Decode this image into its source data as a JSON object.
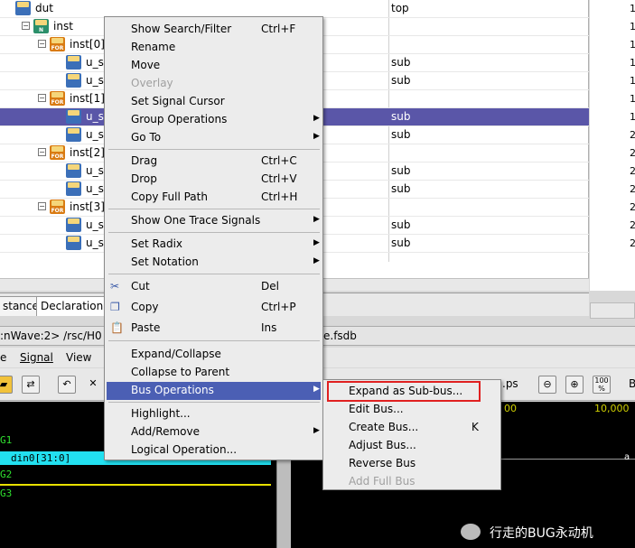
{
  "tree": {
    "rows": [
      {
        "name": "dut",
        "value": "top",
        "icon": "module-icon"
      },
      {
        "name": "inst",
        "value": "",
        "icon": "net-icon"
      },
      {
        "name": "inst[0]",
        "value": "",
        "icon": "for-icon"
      },
      {
        "name": "u_s",
        "value": "sub",
        "icon": "module-icon"
      },
      {
        "name": "u_s",
        "value": "sub",
        "icon": "module-icon"
      },
      {
        "name": "inst[1]",
        "value": "",
        "icon": "for-icon"
      },
      {
        "name": "u_s",
        "value": "sub",
        "icon": "module-icon"
      },
      {
        "name": "u_s",
        "value": "sub",
        "icon": "module-icon"
      },
      {
        "name": "inst[2]",
        "value": "",
        "icon": "for-icon"
      },
      {
        "name": "u_s",
        "value": "sub",
        "icon": "module-icon"
      },
      {
        "name": "u_s",
        "value": "sub",
        "icon": "module-icon"
      },
      {
        "name": "inst[3]",
        "value": "",
        "icon": "for-icon"
      },
      {
        "name": "u_s",
        "value": "sub",
        "icon": "module-icon"
      },
      {
        "name": "u_s",
        "value": "sub",
        "icon": "module-icon"
      }
    ],
    "icon_labels": {
      "net": "N",
      "for": "FOR",
      "module": ""
    },
    "right_column_numbers": [
      "1",
      "1",
      "1",
      "1",
      "1",
      "1",
      "1",
      "2",
      "2",
      "2",
      "2",
      "2",
      "2",
      "2"
    ]
  },
  "tabs": [
    "stance",
    "Declaration"
  ],
  "window_title": ":nWave:2> /rsc/H0",
  "window_title_tail": "e.fsdb",
  "menubar": [
    "e",
    "Signal",
    "View"
  ],
  "toolbar": {
    "time_unit": ".ps",
    "zoom_pct": "100 %",
    "ruler_label": "00",
    "ruler_label_2": "10,000"
  },
  "signals": [
    {
      "name": "G1",
      "color": "#2fe02f"
    },
    {
      "name": "din0[31:0]",
      "color": "#000000"
    },
    {
      "name": "G2",
      "color": "#2fe02f"
    },
    {
      "name": "G3",
      "color": "#2fe02f"
    }
  ],
  "wave_marker": "a",
  "context_menu": {
    "items": [
      {
        "label": "Show Search/Filter",
        "shortcut": "Ctrl+F"
      },
      {
        "label": "Rename"
      },
      {
        "label": "Move"
      },
      {
        "label": "Overlay",
        "disabled": true
      },
      {
        "label": "Set Signal Cursor"
      },
      {
        "label": "Group Operations",
        "submenu": true
      },
      {
        "label": "Go To",
        "submenu": true
      },
      {
        "label": "Drag",
        "shortcut": "Ctrl+C"
      },
      {
        "label": "Drop",
        "shortcut": "Ctrl+V"
      },
      {
        "label": "Copy Full Path",
        "shortcut": "Ctrl+H"
      },
      {
        "label": "Show One Trace Signals",
        "submenu": true
      },
      {
        "label": "Set Radix",
        "submenu": true
      },
      {
        "label": "Set Notation",
        "submenu": true
      },
      {
        "label": "Cut",
        "shortcut": "Del",
        "icon": "scissors-icon"
      },
      {
        "label": "Copy",
        "shortcut": "Ctrl+P",
        "icon": "copy-icon"
      },
      {
        "label": "Paste",
        "shortcut": "Ins",
        "icon": "paste-icon"
      },
      {
        "label": "Expand/Collapse"
      },
      {
        "label": "Collapse to Parent"
      },
      {
        "label": "Bus Operations",
        "submenu": true,
        "highlighted": true
      },
      {
        "label": "Highlight..."
      },
      {
        "label": "Add/Remove",
        "submenu": true
      },
      {
        "label": "Logical Operation..."
      }
    ]
  },
  "bus_submenu": {
    "items": [
      {
        "label": "Expand as Sub-bus..."
      },
      {
        "label": "Edit Bus..."
      },
      {
        "label": "Create Bus...",
        "shortcut": "K"
      },
      {
        "label": "Adjust Bus..."
      },
      {
        "label": "Reverse Bus"
      },
      {
        "label": "Add Full Bus",
        "disabled": true
      }
    ]
  },
  "watermark": "行走的BUG永动机",
  "colors": {
    "selection": "#5a56a8",
    "menu_highlight": "#4b5fb4",
    "callout": "#e02020",
    "cyan_row": "#22e0f0"
  }
}
